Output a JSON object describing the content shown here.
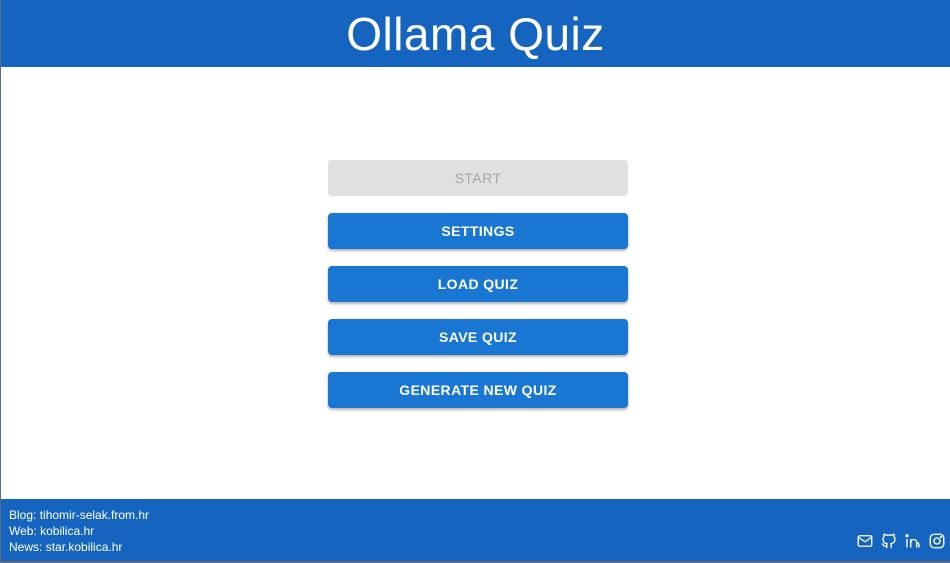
{
  "header": {
    "title": "Ollama Quiz"
  },
  "menu": {
    "start_label": "START",
    "settings_label": "SETTINGS",
    "load_label": "LOAD QUIZ",
    "save_label": "SAVE QUIZ",
    "generate_label": "GENERATE NEW QUIZ"
  },
  "footer": {
    "blog_prefix": "Blog: ",
    "blog": "tihomir-selak.from.hr",
    "web_prefix": "Web: ",
    "web": "kobilica.hr",
    "news_prefix": "News: ",
    "news": "star.kobilica.hr",
    "icons": [
      "mail-icon",
      "github-icon",
      "linkedin-icon",
      "instagram-icon"
    ]
  },
  "colors": {
    "primary": "#1565c0",
    "button": "#1976d2",
    "disabled_bg": "#e0e0e0",
    "disabled_text": "#a6a6a6"
  }
}
